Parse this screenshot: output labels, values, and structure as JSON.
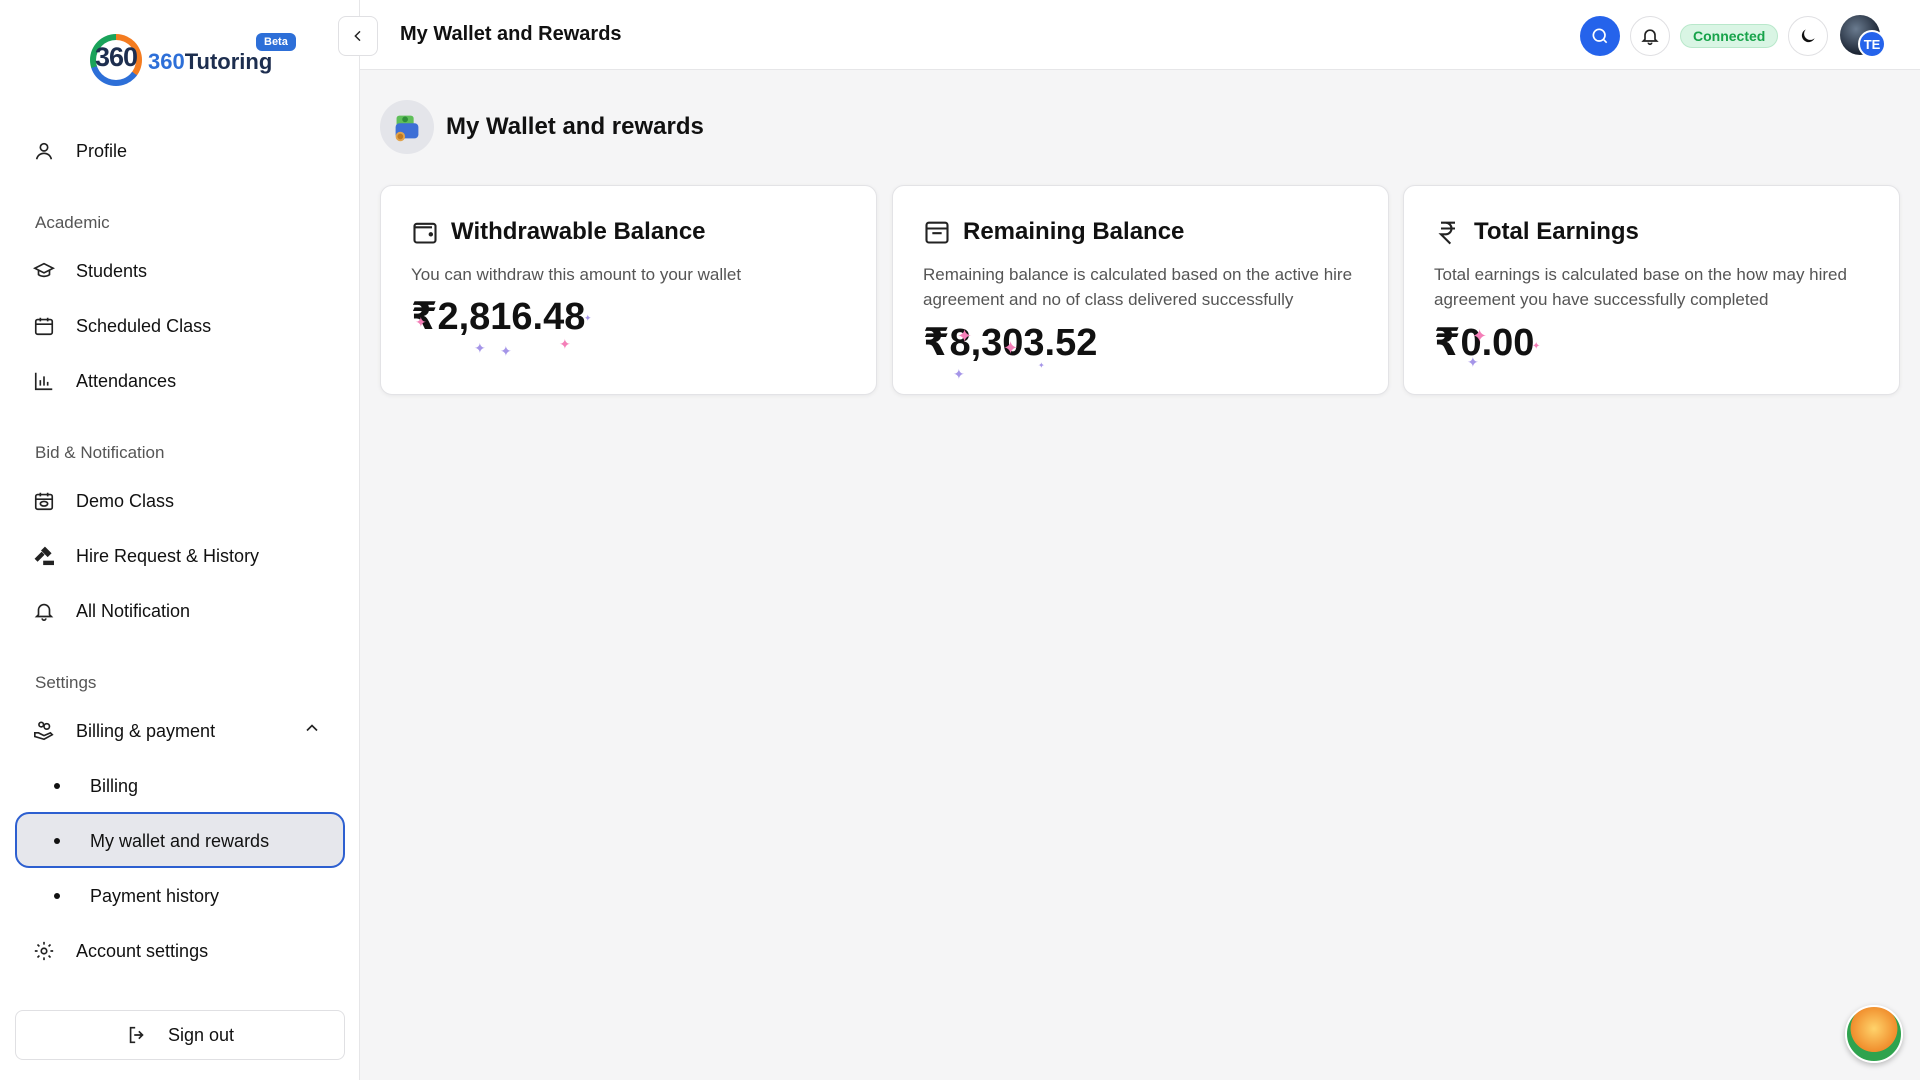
{
  "brand": {
    "logo_number": "360",
    "name_accent": "360",
    "name": "Tutoring",
    "badge": "Beta"
  },
  "sidebar": {
    "profile": "Profile",
    "sections": {
      "academic": "Academic",
      "bid_notification": "Bid & Notification",
      "settings": "Settings"
    },
    "items": {
      "students": "Students",
      "scheduled_class": "Scheduled Class",
      "attendances": "Attendances",
      "demo_class": "Demo Class",
      "hire_request": "Hire Request & History",
      "all_notification": "All Notification",
      "billing_payment": "Billing & payment",
      "billing": "Billing",
      "wallet": "My wallet and rewards",
      "payment_history": "Payment history",
      "account_settings": "Account settings"
    },
    "sign_out": "Sign out"
  },
  "header": {
    "title": "My Wallet and Rewards",
    "status": "Connected",
    "avatar_initials": "TE"
  },
  "main": {
    "title": "My Wallet and rewards",
    "cards": [
      {
        "title": "Withdrawable Balance",
        "description": "You can withdraw this amount to your wallet",
        "amount": "₹2,816.48",
        "icon": "wallet-icon"
      },
      {
        "title": "Remaining Balance",
        "description": "Remaining balance is calculated based on the active hire agreement and no of class delivered successfully",
        "amount": "₹8,303.52",
        "icon": "inbox-icon"
      },
      {
        "title": "Total Earnings",
        "description": "Total earnings is calculated base on the how may hired agreement you have successfully completed",
        "amount": "₹0.00",
        "icon": "rupee-icon"
      }
    ]
  },
  "colors": {
    "accent": "#2563eb",
    "active_border": "#2d5fd0",
    "connected_text": "#17a34a",
    "connected_bg": "#d9f5e4"
  }
}
